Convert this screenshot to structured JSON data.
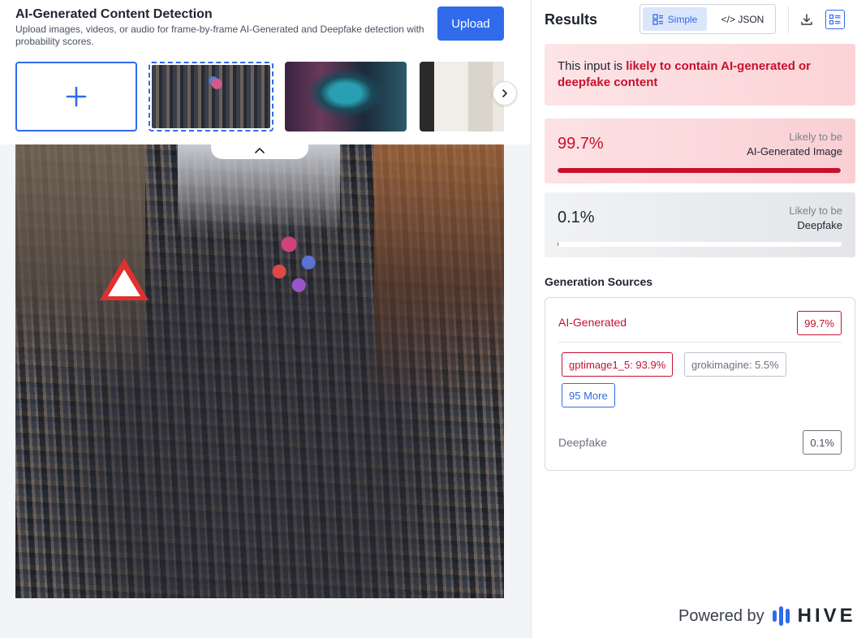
{
  "header": {
    "title": "AI-Generated Content Detection",
    "subtitle": "Upload images, videos, or audio for frame-by-frame AI-Generated and Deepfake detection with probability scores.",
    "upload_label": "Upload"
  },
  "gallery": {
    "add_icon": "plus-icon",
    "next_icon": "chevron-right-icon",
    "collapse_icon": "chevron-up-icon"
  },
  "results": {
    "title": "Results",
    "view_toggle": {
      "simple_label": "Simple",
      "json_label": "</> JSON",
      "active": "Simple"
    },
    "download_icon": "download-icon",
    "view_icon": "list-view-icon",
    "verdict": {
      "prefix": "This input is ",
      "highlight": "likely to contain AI-generated or deepfake content"
    },
    "ai_generated": {
      "percent_text": "99.7%",
      "probability": 0.997,
      "likely_to_be": "Likely to be",
      "kind": "AI-Generated Image"
    },
    "deepfake": {
      "percent_text": "0.1%",
      "probability": 0.001,
      "likely_to_be": "Likely to be",
      "kind": "Deepfake"
    },
    "generation_sources": {
      "heading": "Generation Sources",
      "ai_label": "AI-Generated",
      "ai_score": "99.7%",
      "sources": [
        "gptimage1_5: 93.9%",
        "grokimagine: 5.5%"
      ],
      "more_label": "95 More",
      "deepfake_label": "Deepfake",
      "deepfake_score": "0.1%"
    }
  },
  "footer": {
    "powered_by": "Powered by",
    "brand": "HIVE"
  },
  "colors": {
    "accent": "#2f6bea",
    "alert": "#c8102e"
  }
}
